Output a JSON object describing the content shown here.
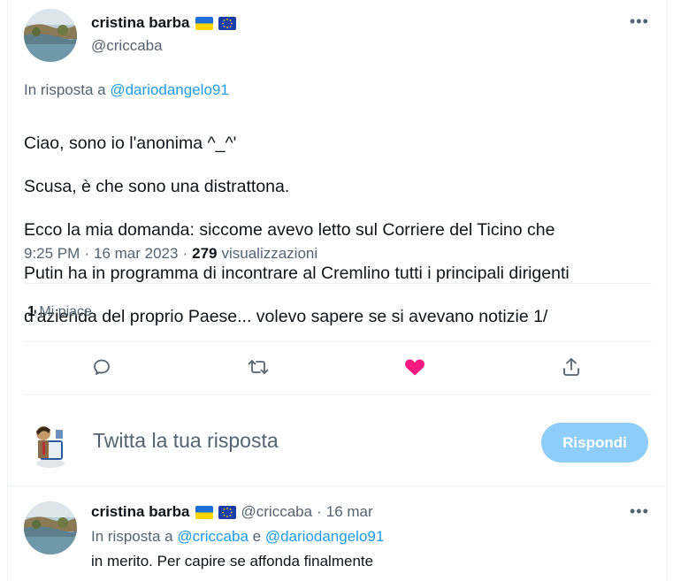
{
  "main_tweet": {
    "author_name": "cristina barba",
    "author_handle": "@criccaba",
    "reply_prefix": "In risposta a",
    "reply_to": "@dariodangelo91",
    "text_lines": [
      "Ciao, sono io l'anonima ^_^'",
      "Scusa, è che sono una distrattona.",
      "Ecco la mia domanda: siccome avevo letto sul Corriere del Ticino che",
      "Putin ha in programma di incontrare al Cremlino tutti i principali dirigenti",
      "d'azienda del proprio Paese... volevo sapere se si avevano notizie 1/"
    ],
    "time": "9:25 PM",
    "date": "16 mar 2023",
    "views_count": "279",
    "views_label": "visualizzazioni",
    "likes_count": "1",
    "likes_label": "Mi piace"
  },
  "actions": {
    "icons": [
      "comment-icon",
      "retweet-icon",
      "heart-filled-icon",
      "share-icon"
    ],
    "heart_color": "#f91880"
  },
  "composer": {
    "placeholder": "Twitta la tua risposta",
    "reply_button": "Rispondi"
  },
  "reply_tweet": {
    "author_name": "cristina barba",
    "author_handle": "@criccaba",
    "date": "16 mar",
    "reply_prefix": "In risposta a",
    "reply_to_1": "@criccaba",
    "reply_conj": "e",
    "reply_to_2": "@dariodangelo91",
    "text": "in merito. Per capire se affonda finalmente"
  },
  "more_icon": "more-horizontal-icon",
  "colors": {
    "accent": "#1d9bf0",
    "muted": "#536471",
    "reply_button_bg": "#8ecdf8"
  }
}
